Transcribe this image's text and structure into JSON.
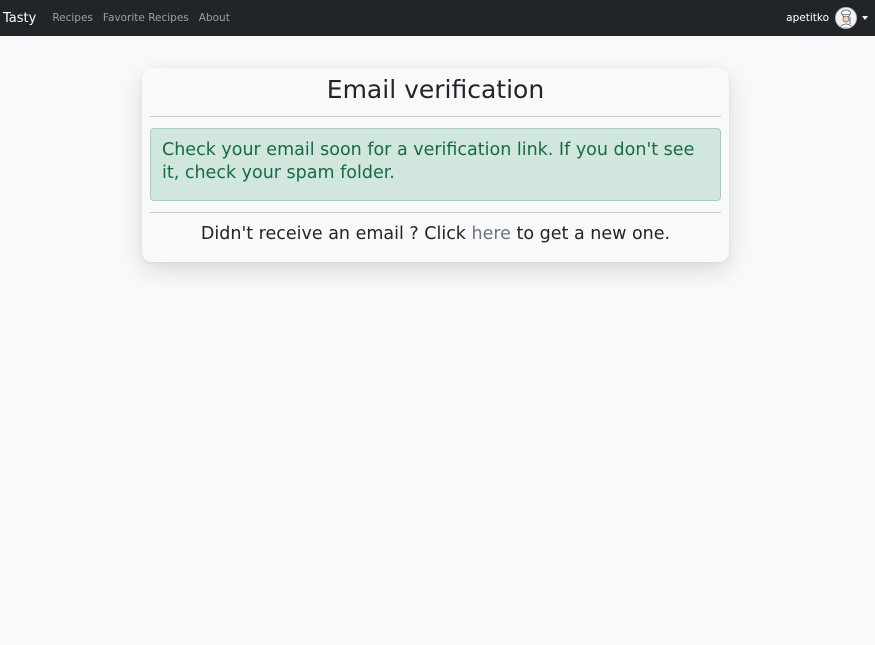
{
  "navbar": {
    "brand": "Tasty",
    "links": [
      {
        "label": "Recipes"
      },
      {
        "label": "Favorite Recipes"
      },
      {
        "label": "About"
      }
    ],
    "user": {
      "username": "apetitko",
      "avatar_icon": "chef-avatar-icon"
    }
  },
  "card": {
    "title": "Email verification",
    "alert_message": "Check your email soon for a verification link. If you don't see it, check your spam folder.",
    "resend_prefix": "Didn't receive an email ? Click ",
    "resend_link": "here",
    "resend_suffix": " to get a new one."
  },
  "colors": {
    "navbar_bg": "#212529",
    "page_bg": "#f8f9fa",
    "alert_bg": "#d1e7dd",
    "alert_text": "#146c43",
    "link_text": "#6c757d"
  }
}
